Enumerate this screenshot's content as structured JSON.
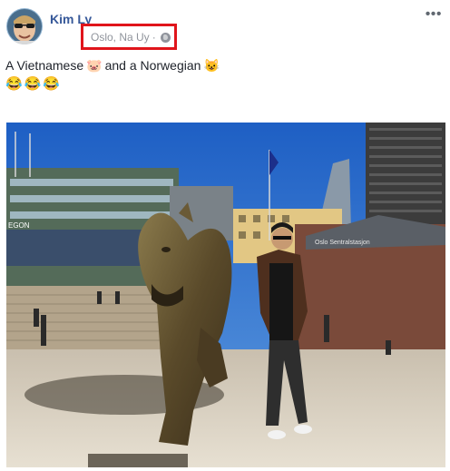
{
  "post": {
    "author_name": "Kim Ly",
    "location": "Oslo, Na Uy",
    "separator": "·",
    "privacy_icon": "globe-icon",
    "more_icon": "more-dots-icon",
    "more_label": "•••",
    "caption_part1": "A Vietnamese",
    "caption_emoji1": "🐷",
    "caption_part2": "and a Norwegian",
    "caption_emoji2": "😺",
    "caption_line2": "😂😂😂",
    "photo_signage": {
      "left_building": "EGON",
      "right_building": "Oslo Sentralstasjon"
    }
  },
  "colors": {
    "author": "#365899",
    "meta": "#90949c",
    "highlight_box": "#e0151b",
    "text": "#1d2129"
  }
}
